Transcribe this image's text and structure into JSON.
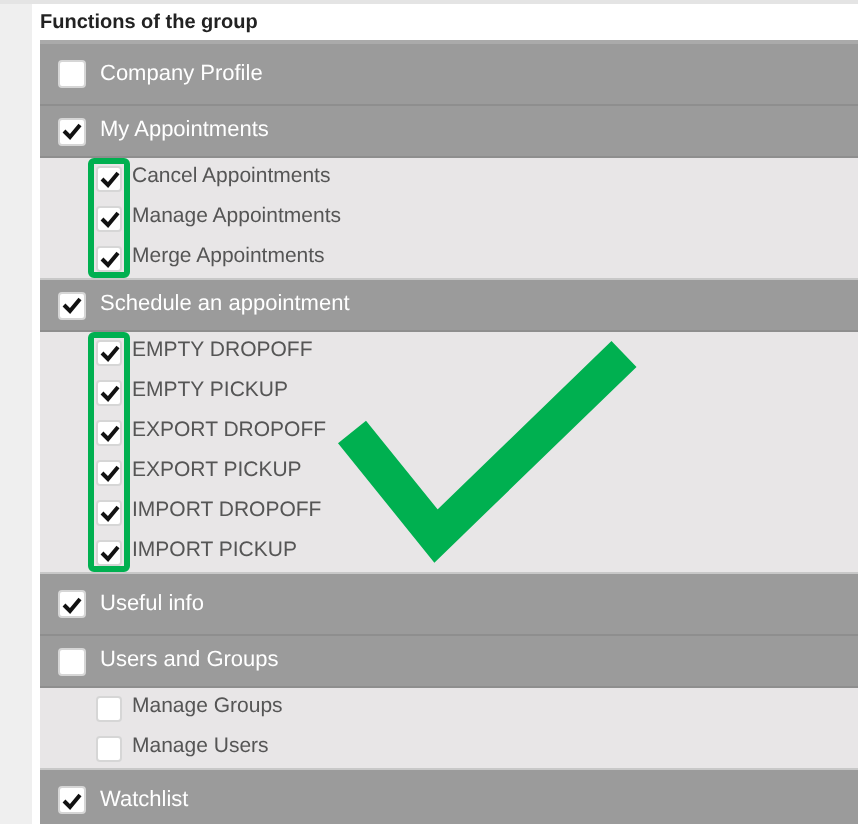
{
  "section_title": "Functions of the group",
  "groups": [
    {
      "label": "Company Profile",
      "checked": false
    },
    {
      "label": "My Appointments",
      "checked": true,
      "highlighted": true,
      "children": [
        {
          "label": "Cancel Appointments",
          "checked": true
        },
        {
          "label": "Manage Appointments",
          "checked": true
        },
        {
          "label": "Merge Appointments",
          "checked": true
        }
      ]
    },
    {
      "label": "Schedule an appointment",
      "checked": true,
      "highlighted": true,
      "children": [
        {
          "label": "EMPTY DROPOFF",
          "checked": true
        },
        {
          "label": "EMPTY PICKUP",
          "checked": true
        },
        {
          "label": "EXPORT DROPOFF",
          "checked": true
        },
        {
          "label": "EXPORT PICKUP",
          "checked": true
        },
        {
          "label": "IMPORT DROPOFF",
          "checked": true
        },
        {
          "label": "IMPORT PICKUP",
          "checked": true
        }
      ]
    },
    {
      "label": "Useful info",
      "checked": true
    },
    {
      "label": "Users and Groups",
      "checked": false,
      "children": [
        {
          "label": "Manage Groups",
          "checked": false
        },
        {
          "label": "Manage Users",
          "checked": false
        }
      ]
    },
    {
      "label": "Watchlist",
      "checked": true
    }
  ]
}
